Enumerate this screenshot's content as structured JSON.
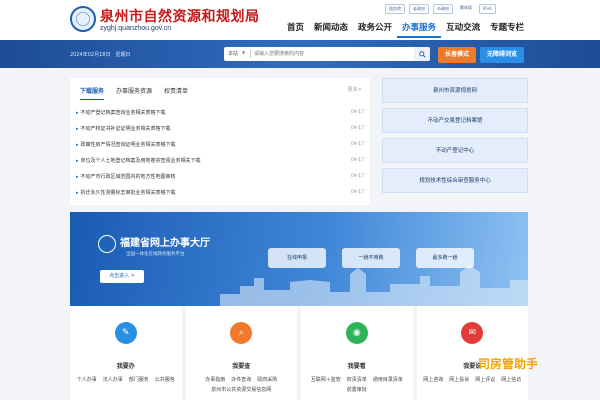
{
  "header": {
    "site_name": "泉州市自然资源和规划局",
    "domain": "zyghj.quanzhou.gov.cn",
    "top_links": [
      "国务院",
      "省政府",
      "市政府",
      "繁体版",
      "IPv6"
    ],
    "nav": [
      "首页",
      "新闻动态",
      "政务公开",
      "办事服务",
      "互动交流",
      "专题专栏"
    ],
    "nav_active_index": 3
  },
  "banner": {
    "date": "2024年02月18日　星期日",
    "search_scope": "本站",
    "search_placeholder": "请输入您要搜索的内容",
    "elder_mode": "长者模式",
    "accessible": "无障碍浏览"
  },
  "panel": {
    "tabs": [
      "下载服务",
      "办事服务资源",
      "权责清单"
    ],
    "active_tab": 0,
    "more": "更多>",
    "items": [
      {
        "title": "不动产登记档案查询业务相关表格下载",
        "date": "09-17"
      },
      {
        "title": "不动产权证书补证证明业务相关表格下载",
        "date": "09-17"
      },
      {
        "title": "政策性房产情况查询证明业务相关表格下载",
        "date": "09-17"
      },
      {
        "title": "单位及个人土地登记档案及用地卷宗查阅业务相关下载",
        "date": "09-17"
      },
      {
        "title": "不动产市行政区域范围内的地方性地图审核",
        "date": "09-17"
      },
      {
        "title": "拆迁永久性测量标志审批业务相关表格下载",
        "date": "09-17"
      }
    ]
  },
  "quick_links": [
    "泉州市资源规划网",
    "不动产交易登记档案馆",
    "不动产登记中心",
    "规划技术性综合审查服务中心"
  ],
  "hall": {
    "title": "福建省网上办事大厅",
    "subtitle": "全国一体化在线政务服务平台",
    "enter": "点击进入 >",
    "cards": [
      "在线申报",
      "一趟不用跑",
      "最多跑一趟"
    ]
  },
  "service_cards": [
    {
      "title": "我要办",
      "color": "#2c8fe6",
      "links": [
        "个人办事",
        "法人办事",
        "部门服务",
        "公共服务"
      ]
    },
    {
      "title": "我要查",
      "color": "#f07a2a",
      "links": [
        "办事指南",
        "办件查询",
        "政府采购",
        "泉州市公共资源交易信息网"
      ]
    },
    {
      "title": "我要看",
      "color": "#2fb35a",
      "links": [
        "互联网＋监管",
        "权责清单",
        "通用目录清单",
        "前置审批"
      ]
    },
    {
      "title": "我要说",
      "color": "#e23b3b",
      "links": [
        "网上咨询",
        "网上投诉",
        "网上评议",
        "网上信访"
      ]
    }
  ],
  "watermark": "司房管助手"
}
